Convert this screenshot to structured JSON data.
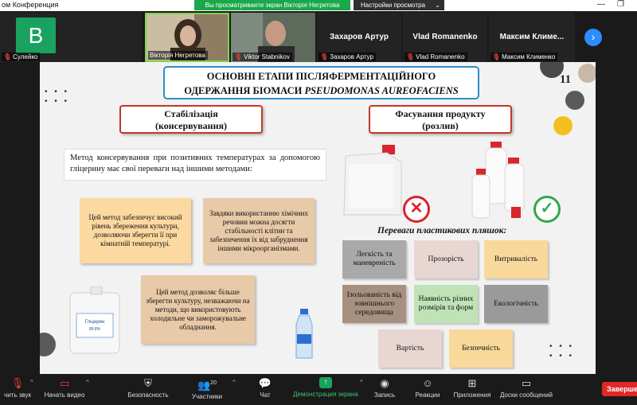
{
  "window": {
    "title": "ом Конференция",
    "share_banner": "Вы просматриваете экран Вікторія Негретова",
    "view_options": "Настройки просмотра",
    "minimize_glyph": "—",
    "restore_glyph": "❐"
  },
  "participants": [
    {
      "name": "Сулейко",
      "avatar_letter": "B",
      "muted": true
    },
    {
      "name": "Вікторія Негретова",
      "muted": false,
      "active": true
    },
    {
      "name": "Viktor Stabnikov",
      "muted": true
    },
    {
      "name": "Захаров Артур",
      "muted": true
    },
    {
      "name": "Vlad Romanenko",
      "muted": true
    },
    {
      "name": "Максим Клименко",
      "big_name": "Максим Климе...",
      "muted": true
    }
  ],
  "gallery_next_glyph": "›",
  "slide": {
    "title_line1": "ОСНОВНІ ЕТАПИ ПІСЛЯФЕРМЕНТАЦІЙНОГО",
    "title_line2_plain": "ОДЕРЖАННЯ БІОМАСИ ",
    "title_line2_italic": "PSEUDOMONAS AUREOFACIENS",
    "page_number": "11",
    "left_heading_line1": "Стабілізація",
    "left_heading_line2": "(консервування)",
    "right_heading_line1": "Фасування продукту",
    "right_heading_line2": "(розлив)",
    "method_text": "Метод консервування при позитивних температурах за допомогою гліцерину має свої переваги над іншими методами:",
    "note1": "Цей метод забезпечує високий рівень збереження культури, дозволяючи зберегти її при кімнатній температурі.",
    "note2": "Завдяки використанню хімічних речовин можна досягти стабільності клітин та забезпечення їх від забруднення іншими мікроорганізмами.",
    "note3": "Цей метод дозволяє більше зберегти культуру, незважаючи на методи, що використовують холодильне чи заморожувальне обладнання.",
    "glycerin_label": "Гліцерин",
    "glycerin_sub": "99,8%",
    "advantages_title": "Переваги пластикових пляшок:",
    "advantages": [
      "Легкість та маневреність",
      "Прозорість",
      "Витривалість",
      "Ізольованість від зовнішнього середовища",
      "Наявність різних розмірів та форм",
      "Екологічність",
      "Вартість",
      "Безпечність"
    ],
    "colors": {
      "title_border": "#2e8cc7",
      "heading_border": "#c0392b",
      "note_yellow": "#fcd9a0",
      "note_tan": "#e8c9a8",
      "adv_grey": "#a9a9a9",
      "adv_pink": "#e8d6d2",
      "adv_orange": "#f9d89c",
      "adv_brown": "#a89080",
      "adv_green": "#bfe3b5",
      "adv_dark": "#9a9a9a"
    }
  },
  "toolbar": {
    "items": [
      {
        "label": "чить звук",
        "icon": "microphone-off-icon"
      },
      {
        "label": "Начать видео",
        "icon": "video-off-icon"
      },
      {
        "label": "Безопасность",
        "icon": "shield-icon"
      },
      {
        "label": "Участники",
        "icon": "participants-icon",
        "count": "20"
      },
      {
        "label": "Чат",
        "icon": "chat-icon"
      },
      {
        "label": "Демонстрация экрана",
        "icon": "share-screen-icon"
      },
      {
        "label": "Запись",
        "icon": "record-icon"
      },
      {
        "label": "Реакции",
        "icon": "reactions-icon"
      },
      {
        "label": "Приложения",
        "icon": "apps-icon"
      },
      {
        "label": "Доски сообщений",
        "icon": "whiteboard-icon"
      }
    ],
    "end_label": "Завершен"
  }
}
